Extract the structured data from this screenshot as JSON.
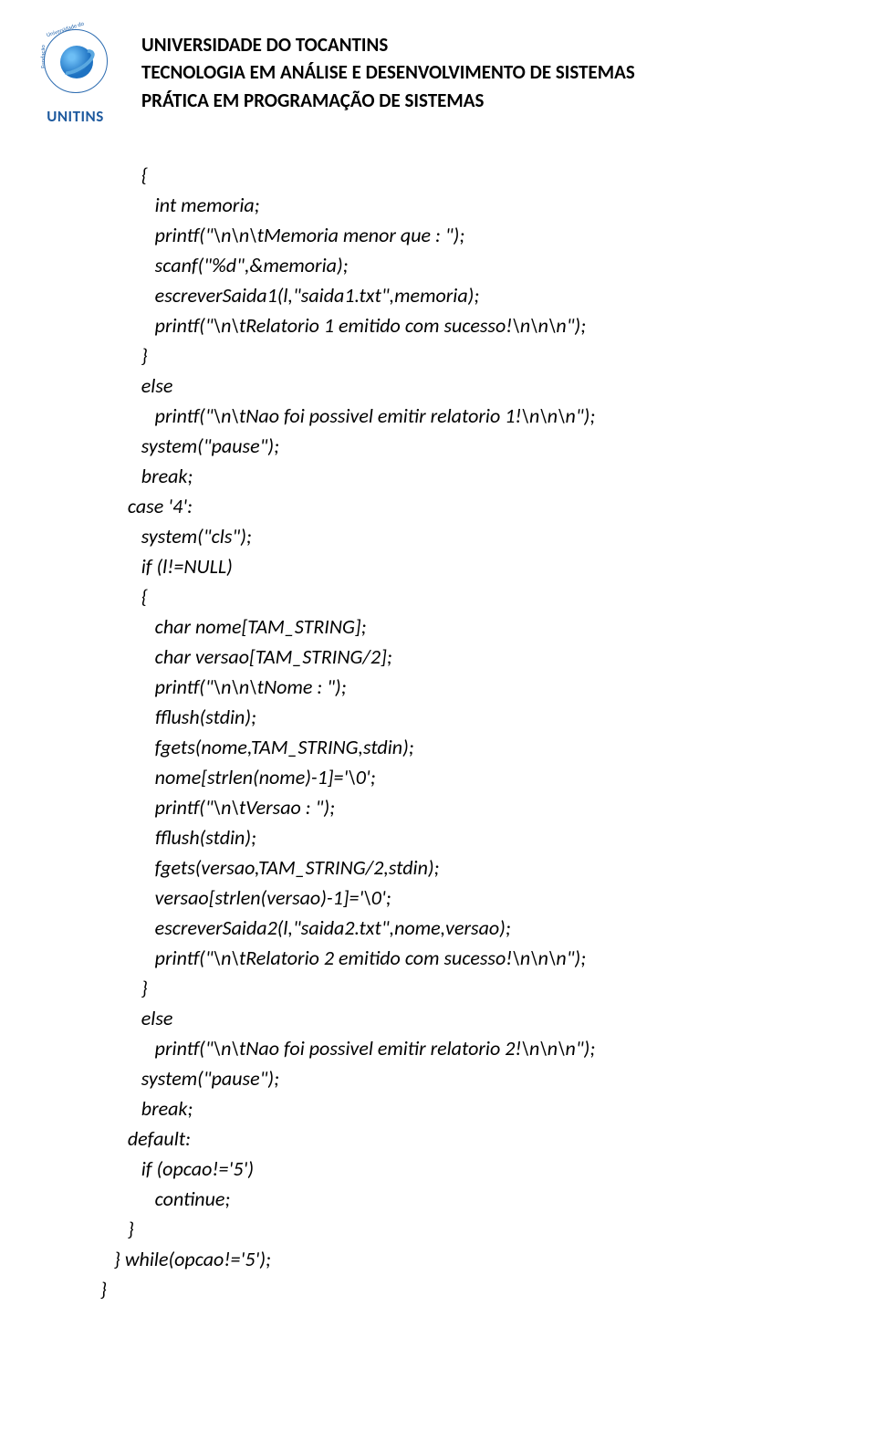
{
  "header": {
    "logo_brand": "UNITINS",
    "logo_ring_top": "Universidade do",
    "logo_ring_left": "Fundação",
    "line1": "UNIVERSIDADE DO TOCANTINS",
    "line2": "TECNOLOGIA EM ANÁLISE E DESENVOLVIMENTO DE SISTEMAS",
    "line3": "PRÁTICA EM PROGRAMAÇÃO DE SISTEMAS"
  },
  "code": "         {\n            int memoria;\n            printf(\"\\n\\n\\tMemoria menor que : \");\n            scanf(\"%d\",&memoria);\n            escreverSaida1(l,\"saida1.txt\",memoria);\n            printf(\"\\n\\tRelatorio 1 emitido com sucesso!\\n\\n\\n\");\n         }\n         else\n            printf(\"\\n\\tNao foi possivel emitir relatorio 1!\\n\\n\\n\");\n         system(\"pause\");\n         break;\n      case '4':\n         system(\"cls\");\n         if (l!=NULL)\n         {\n            char nome[TAM_STRING];\n            char versao[TAM_STRING/2];\n            printf(\"\\n\\n\\tNome : \");\n            fflush(stdin);\n            fgets(nome,TAM_STRING,stdin);\n            nome[strlen(nome)-1]='\\0';\n            printf(\"\\n\\tVersao : \");\n            fflush(stdin);\n            fgets(versao,TAM_STRING/2,stdin);\n            versao[strlen(versao)-1]='\\0';\n            escreverSaida2(l,\"saida2.txt\",nome,versao);\n            printf(\"\\n\\tRelatorio 2 emitido com sucesso!\\n\\n\\n\");\n         }\n         else\n            printf(\"\\n\\tNao foi possivel emitir relatorio 2!\\n\\n\\n\");\n         system(\"pause\");\n         break;\n      default:\n         if (opcao!='5')\n            continue;\n      }\n   } while(opcao!='5');\n}"
}
